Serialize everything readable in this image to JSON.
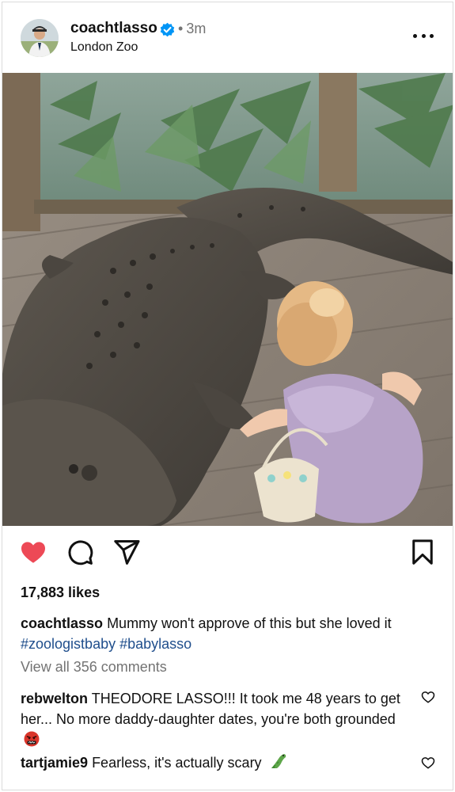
{
  "post": {
    "username": "coachtlasso",
    "verified": true,
    "separator": "•",
    "time_ago": "3m",
    "location": "London Zoo"
  },
  "actions": {
    "like_icon": "heart-filled-icon",
    "comment_icon": "comment-icon",
    "share_icon": "send-icon",
    "save_icon": "bookmark-icon",
    "like_color": "#ed4956"
  },
  "likes": "17,883 likes",
  "caption": {
    "username": "coachtlasso",
    "text": "Mummy won't approve of this but she loved it",
    "hashtag1": "#zoologistbaby",
    "hashtag2": "#babylasso"
  },
  "view_comments": "View all 356 comments",
  "comments": [
    {
      "username": "rebwelton",
      "text": "THEODORE LASSO!!! It took me 48 years to get her... No more daddy-daughter dates, you're both grounded",
      "emoji": "angry-cursing-face-emoji"
    },
    {
      "username": "tartjamie9",
      "text": "Fearless, it's actually scary",
      "emoji": "crocodile-emoji"
    }
  ]
}
